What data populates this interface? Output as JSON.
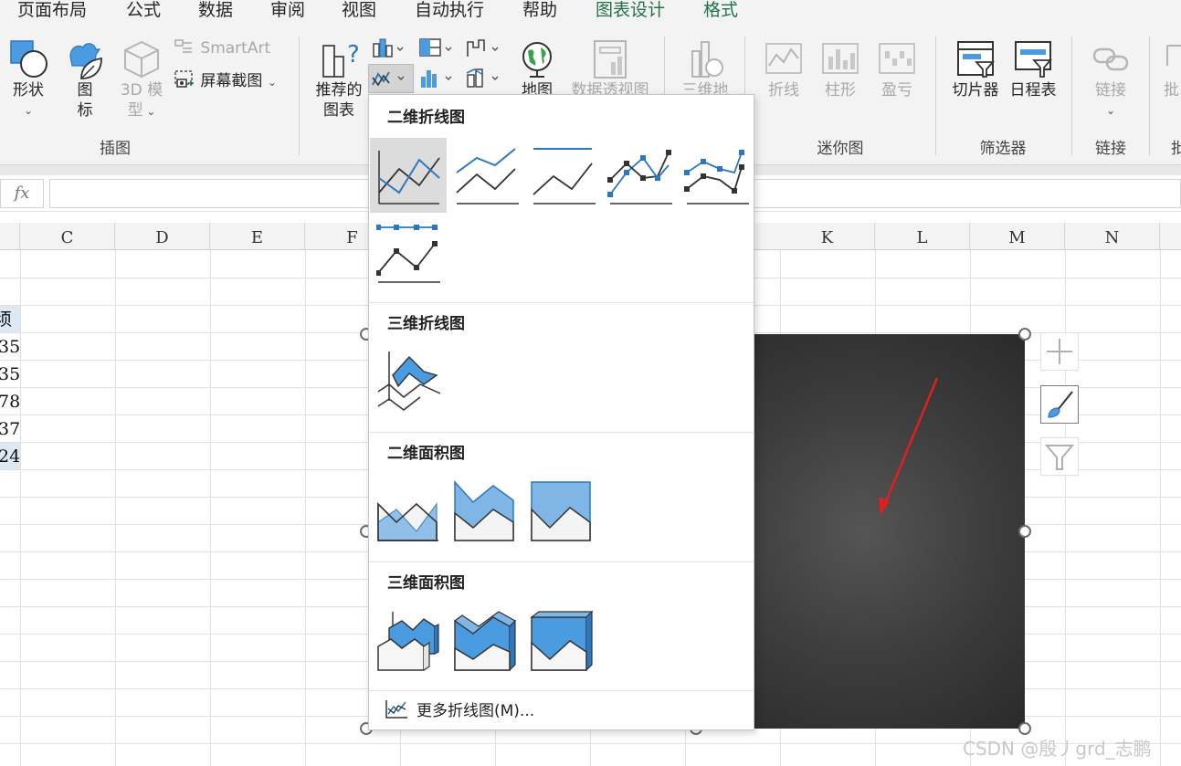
{
  "ribbon": {
    "tabs": [
      {
        "label": "页面布局"
      },
      {
        "label": "公式"
      },
      {
        "label": "数据"
      },
      {
        "label": "审阅"
      },
      {
        "label": "视图"
      },
      {
        "label": "自动执行"
      },
      {
        "label": "帮助"
      },
      {
        "label": "图表设计"
      },
      {
        "label": "格式"
      }
    ],
    "illustrations": {
      "shapes_label": "形状",
      "icons_label_1": "图",
      "icons_label_2": "标",
      "model3d_label_1": "3D 模",
      "model3d_label_2": "型",
      "smartart_label": "SmartArt",
      "screenshot_label": "屏幕截图",
      "group_label": "插图"
    },
    "charts": {
      "recommended_label_1": "推荐的",
      "recommended_label_2": "图表",
      "map_label": "地图",
      "pivotchart_label": "数据透视图"
    },
    "tours": {
      "map3d_label": "三维地"
    },
    "sparklines": {
      "line_label": "折线",
      "column_label": "柱形",
      "winloss_label": "盈亏",
      "group_label": "迷你图"
    },
    "filters": {
      "slicer_label": "切片器",
      "timeline_label": "日程表",
      "group_label": "筛选器"
    },
    "links": {
      "link_label": "链接",
      "group_label": "链接",
      "partial_label": "批",
      "partial_group_label": "批"
    }
  },
  "formula_bar": {
    "fx_label": "fx",
    "value": ""
  },
  "grid": {
    "columns": [
      "C",
      "D",
      "E",
      "F",
      "K",
      "L",
      "M",
      "N"
    ],
    "cells_partial": [
      "须",
      "35",
      "35",
      "78",
      "37",
      "24"
    ]
  },
  "chart_dropdown": {
    "sections": [
      {
        "title": "二维折线图"
      },
      {
        "title": "三维折线图"
      },
      {
        "title": "二维面积图"
      },
      {
        "title": "三维面积图"
      }
    ],
    "more_label": "更多折线图(M)..."
  },
  "colors": {
    "accent_green": "#217346",
    "chart_blue": "#2e8bd0",
    "chart_fill_blue": "#7fb6e6"
  },
  "watermark": "CSDN @殷丿grd_志鹏"
}
